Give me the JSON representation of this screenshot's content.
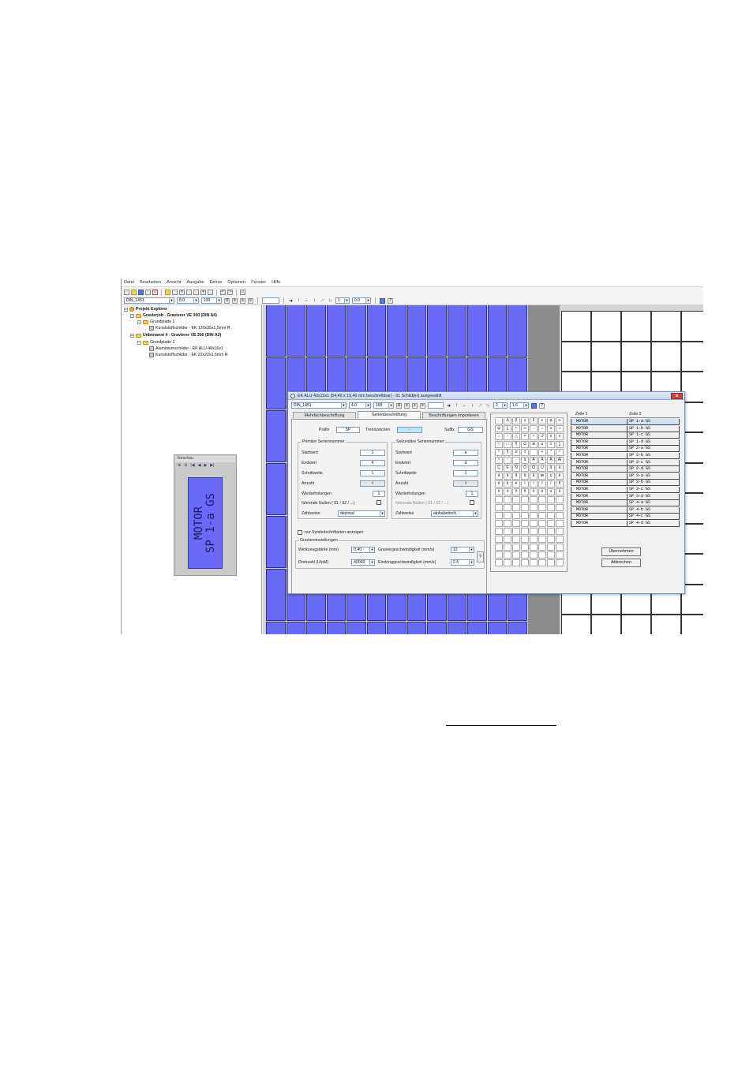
{
  "menu": [
    "Datei",
    "Bearbeiten",
    "Ansicht",
    "Ausgabe",
    "Extras",
    "Optionen",
    "Fenster",
    "Hilfe"
  ],
  "toolbar": {
    "font": "DIN_1451",
    "size": "8.0",
    "width": "100",
    "spacing": "0.0",
    "line": "1"
  },
  "explorer": {
    "root": "Projekt Explorer",
    "items": [
      {
        "label": "Gravierjob - Gravierer VE 300 (DIN A4)"
      },
      {
        "label": "Grundplatte 1"
      },
      {
        "label": "Kunststoffschilder - EK 120x35x1,5mm R"
      },
      {
        "label": "Unbenannt 4 - Gravierer VE 300 (DIN A3)"
      },
      {
        "label": "Grundplatte 1"
      },
      {
        "label": "Aluminiumschilder - EK ALU 40x16x1"
      },
      {
        "label": "Kunststoffschilder - EK 22x22x1,5mm R"
      }
    ]
  },
  "preview": {
    "title": "Vorschau",
    "line1": "MOTOR",
    "line2": "SP 1-a GS"
  },
  "dialog": {
    "title": "EK ALU 40x15x1 (54,40 x 19,40 mm beschreibbar) - 91 Schild(er) ausgewählt",
    "close": "x",
    "toolbar": {
      "font": "DIN_1451",
      "size": "4.0",
      "width": "100",
      "line": "2",
      "spacing": "1.6"
    },
    "tabs": [
      "Mehrfachbeschriftung",
      "Serienbeschriftung",
      "Beschriftungen importieren"
    ],
    "prefix_label": "Präfix",
    "prefix_value": "SP",
    "sep_label": "Trennzeichen",
    "sep_value": "-",
    "suffix_label": "Suffix",
    "suffix_value": "GS",
    "primary": {
      "title": "Primäre Seriennummer",
      "start_label": "Startwert",
      "start": "1",
      "end_label": "Endwert",
      "end": "4",
      "step_label": "Schrittweite",
      "step": "1",
      "count_label": "Anzahl",
      "count": "4",
      "rep_label": "Wiederholungen",
      "rep": "1",
      "zeros_label": "führende Nullen ( 01 / 02 / ...)",
      "mode_label": "Zählweise",
      "mode": "dezimal"
    },
    "secondary": {
      "title": "Sekundäre Seriennummer",
      "start_label": "Startwert",
      "start": "a",
      "end_label": "Endwert",
      "end": "d",
      "step_label": "Schrittweite",
      "step": "1",
      "count_label": "Anzahl",
      "count": "4",
      "rep_label": "Wiederholungen",
      "rep": "1",
      "zeros_label": "führende Nullen ( 01 / 02 / ...)",
      "mode_label": "Zählweise",
      "mode": "alphabetisch"
    },
    "symbol_only": "nur Symbolschriftarten anzeigen",
    "engrave": {
      "title": "Graviereinstellungen",
      "tool_label": "Werkzeugstärke (mm)",
      "tool": "0.40",
      "speed_label": "Graviergeschwindigkeit (mm/s)",
      "speed": "12",
      "rpm_label": "Drehzahl (U/pM)",
      "rpm": "40000",
      "plunge_label": "Eindringgeschwindigkeit (mm/s)",
      "plunge": "2.5"
    },
    "symbols": [
      "←",
      "Δ",
      "β",
      "γ",
      "δ",
      "ε",
      "φ",
      "≥",
      "ψ",
      "∑",
      "≈",
      "∞",
      "→",
      "↔",
      "≤",
      "⊥",
      "↓",
      "↑",
      "△",
      "≠",
      "≈",
      "↺",
      "∧",
      "∨",
      "▽",
      "□",
      "§",
      "Ω",
      "⊕",
      "µ",
      "±",
      "∑",
      "!",
      "§",
      "ø",
      "±",
      "­",
      "+",
      "°",
      "²",
      "³",
      "¹",
      "·",
      "ä",
      "Ä",
      "Ä",
      "Å",
      "Æ",
      "Ç",
      "É",
      "Ñ",
      "Ö",
      "Ö",
      "Ü",
      "ß",
      "à",
      "á",
      "â",
      "ã",
      "ä",
      "å",
      "æ",
      "ç",
      "è",
      "é",
      "ê",
      "ë",
      "ì",
      "í",
      "î",
      "ï",
      "ñ",
      "ò",
      "ó",
      "ô",
      "õ",
      "ö",
      "ù",
      "ú",
      "û"
    ],
    "table": {
      "col1": "Zeile 1",
      "col2": "Zeile 2",
      "rows": [
        [
          "MOTOR",
          "SP 1-a GS"
        ],
        [
          "MOTOR",
          "SP 1-b GS"
        ],
        [
          "MOTOR",
          "SP 1-c GS"
        ],
        [
          "MOTOR",
          "SP 1-d GS"
        ],
        [
          "MOTOR",
          "SP 2-a GS"
        ],
        [
          "MOTOR",
          "SP 2-b GS"
        ],
        [
          "MOTOR",
          "SP 2-c GS"
        ],
        [
          "MOTOR",
          "SP 2-d GS"
        ],
        [
          "MOTOR",
          "SP 3-a GS"
        ],
        [
          "MOTOR",
          "SP 3-b GS"
        ],
        [
          "MOTOR",
          "SP 3-c GS"
        ],
        [
          "MOTOR",
          "SP 3-d GS"
        ],
        [
          "MOTOR",
          "SP 4-a GS"
        ],
        [
          "MOTOR",
          "SP 4-b GS"
        ],
        [
          "MOTOR",
          "SP 4-c GS"
        ],
        [
          "MOTOR",
          "SP 4-d GS"
        ]
      ]
    },
    "ok_label": "Übernehmen",
    "cancel_label": "Abbrechen"
  }
}
